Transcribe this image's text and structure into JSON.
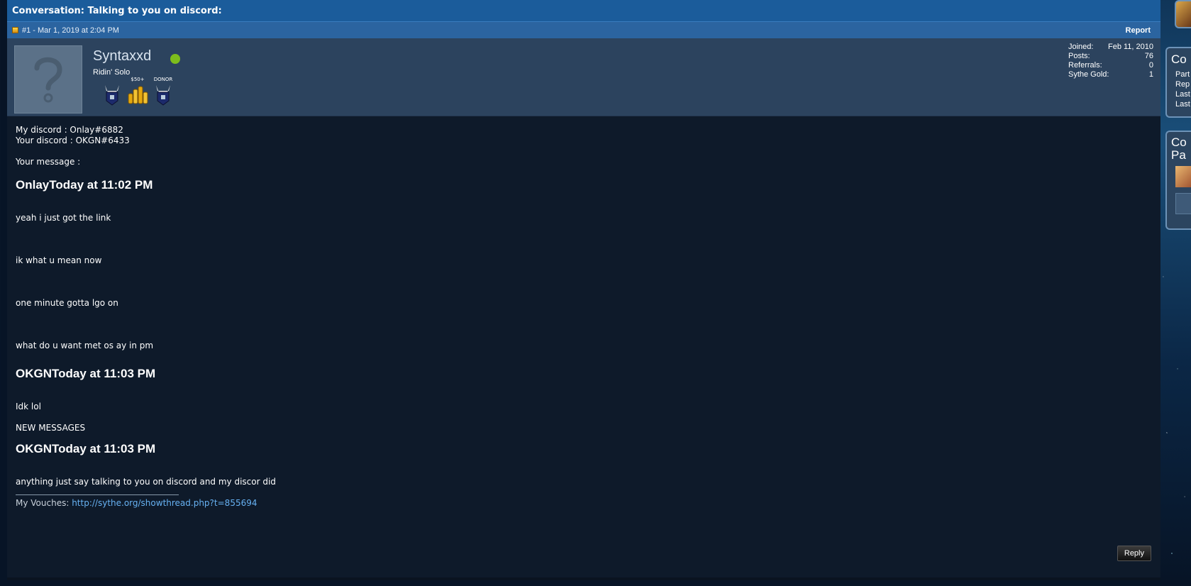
{
  "post": {
    "title": "Conversation: Talking to you on discord:",
    "meta": "#1 - Mar 1, 2019 at 2:04 PM",
    "report_label": "Report",
    "reply_label": "Reply"
  },
  "user": {
    "name": "Syntaxxd",
    "title": "Ridin' Solo",
    "badges": [
      {
        "caption": "",
        "icon": "horned-helmet-icon"
      },
      {
        "caption": "$50+",
        "icon": "gold-coins-icon"
      },
      {
        "caption": "DONOR",
        "icon": "horned-helmet-icon"
      }
    ],
    "stats": [
      {
        "label": "Joined:",
        "value": "Feb 11, 2010"
      },
      {
        "label": "Posts:",
        "value": "76"
      },
      {
        "label": "Referrals:",
        "value": "0"
      },
      {
        "label": "Sythe Gold:",
        "value": "1"
      }
    ]
  },
  "message": {
    "lines": [
      "My discord : Onlay#6882",
      "Your discord : OKGN#6433",
      "Your message :",
      "OnlayToday at 11:02 PM",
      "yeah i just got the link",
      "ik what u mean now",
      "one minute gotta lgo on",
      "what do u want met os ay in pm",
      "OKGNToday at 11:03 PM",
      "Idk lol",
      "NEW MESSAGES",
      "OKGNToday at 11:03 PM",
      "anything just say talking to you on discord and my discor did"
    ]
  },
  "signature": {
    "prefix": "My Vouches:",
    "link": "http://sythe.org/showthread.php?t=855694"
  },
  "sidebar": {
    "box1_lines": [
      "Co",
      "Part",
      "Rep",
      "Last",
      "Last"
    ],
    "box2_lines": [
      "Co",
      "Pa"
    ]
  }
}
